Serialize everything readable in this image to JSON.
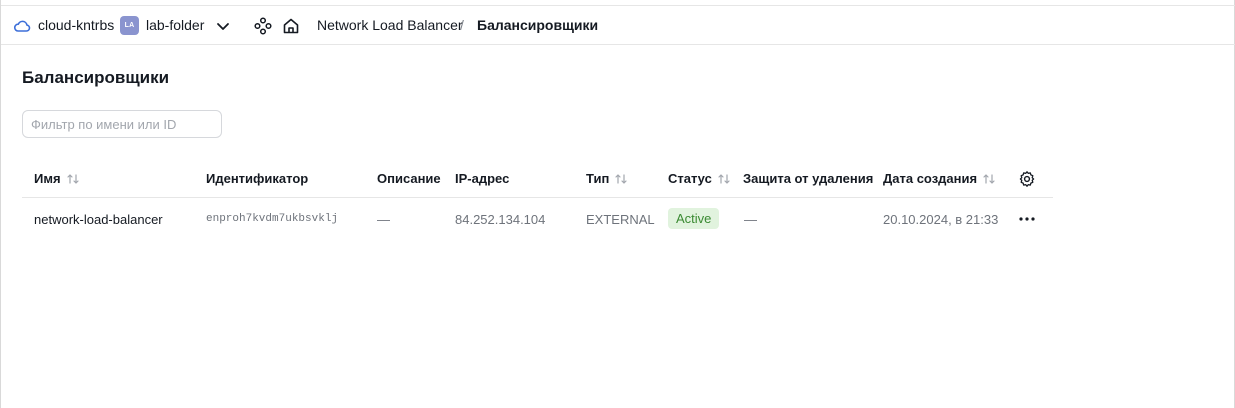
{
  "header": {
    "cloud_name": "cloud-kntrbs",
    "folder_badge": "LA",
    "folder_name": "lab-folder",
    "breadcrumb": {
      "service": "Network Load Balancer",
      "separator": "/",
      "current": "Балансировщики"
    }
  },
  "page": {
    "title": "Балансировщики",
    "filter_placeholder": "Фильтр по имени или ID"
  },
  "table": {
    "columns": [
      {
        "label": "Имя",
        "sortable": true
      },
      {
        "label": "Идентификатор",
        "sortable": false
      },
      {
        "label": "Описание",
        "sortable": false
      },
      {
        "label": "IP-адрес",
        "sortable": false
      },
      {
        "label": "Тип",
        "sortable": true
      },
      {
        "label": "Статус",
        "sortable": true
      },
      {
        "label": "Защита от удаления",
        "sortable": false
      },
      {
        "label": "Дата создания",
        "sortable": true
      }
    ],
    "rows": [
      {
        "name": "network-load-balancer",
        "id": "enproh7kvdm7ukbsvklj",
        "description": "—",
        "ip": "84.252.134.104",
        "type": "EXTERNAL",
        "status": "Active",
        "deletion_protection": "—",
        "created": "20.10.2024, в 21:33"
      }
    ]
  },
  "icons": {
    "cloud": "cloud-icon",
    "chevron": "chevron-down-icon",
    "services": "services-grid-icon",
    "home": "home-icon",
    "sort": "sort-arrows-icon",
    "settings": "gear-icon",
    "more": "more-horizontal-icon"
  },
  "colors": {
    "status_active_bg": "#e1f3de",
    "status_active_text": "#3a8a32",
    "folder_badge_bg": "#8a94cf",
    "cloud_icon": "#3d6fd9"
  }
}
